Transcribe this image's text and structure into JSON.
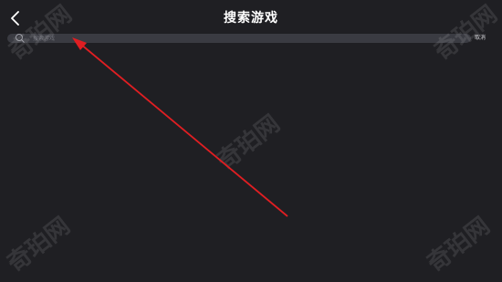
{
  "header": {
    "title": "搜索游戏",
    "back_icon": "chevron-left-icon"
  },
  "search": {
    "placeholder": "搜索游戏",
    "icon": "search-icon",
    "cancel_label": "取消"
  },
  "watermark": {
    "text": "奇珀网"
  },
  "colors": {
    "background": "#1f1f23",
    "search_bar": "#3a3b42",
    "annotation_arrow": "#e01e22"
  }
}
